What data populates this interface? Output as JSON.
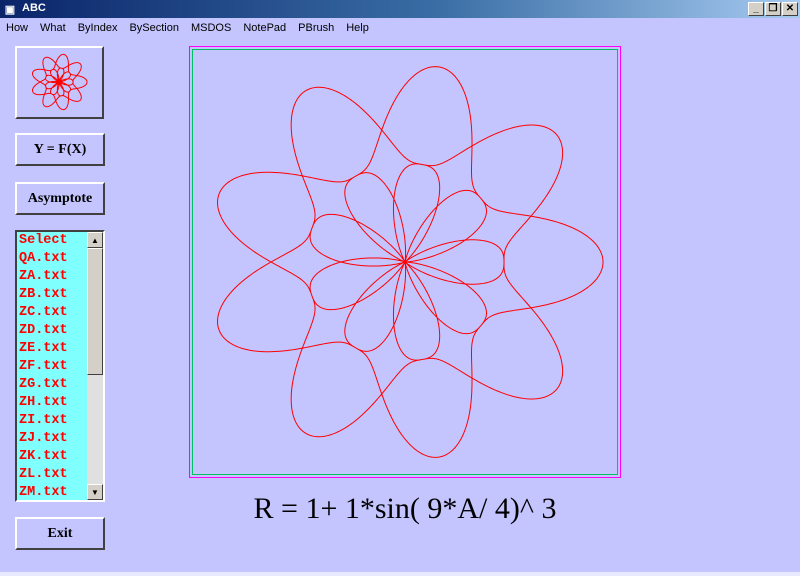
{
  "window": {
    "title": "ABC",
    "icon": "app-icon",
    "controls": {
      "minimize": "_",
      "maximize": "❐",
      "close": "✕"
    }
  },
  "menu": [
    "How",
    "What",
    "ByIndex",
    "BySection",
    "MSDOS",
    "NotePad",
    "PBrush",
    "Help"
  ],
  "buttons": {
    "yfx": "Y = F(X)",
    "asymptote": "Asymptote",
    "exit": "Exit"
  },
  "file_list": {
    "items": [
      "Select",
      "QA.txt",
      "ZA.txt",
      "ZB.txt",
      "ZC.txt",
      "ZD.txt",
      "ZE.txt",
      "ZF.txt",
      "ZG.txt",
      "ZH.txt",
      "ZI.txt",
      "ZJ.txt",
      "ZK.txt",
      "ZL.txt",
      "ZM.txt"
    ],
    "scroll_position": 0.0
  },
  "plot": {
    "equation": {
      "a": 1,
      "b": 1,
      "n": 9,
      "d": 4,
      "p": 3
    },
    "curve_color": "#ff0000",
    "frame_color": "#ff00ff",
    "inner_frame_color": "#00c060"
  },
  "formula_text": "R = 1+ 1*sin( 9*A/ 4)^ 3",
  "colors": {
    "background": "#c4c4ff",
    "list_bg": "#80ffff",
    "list_text": "#ff0000"
  }
}
